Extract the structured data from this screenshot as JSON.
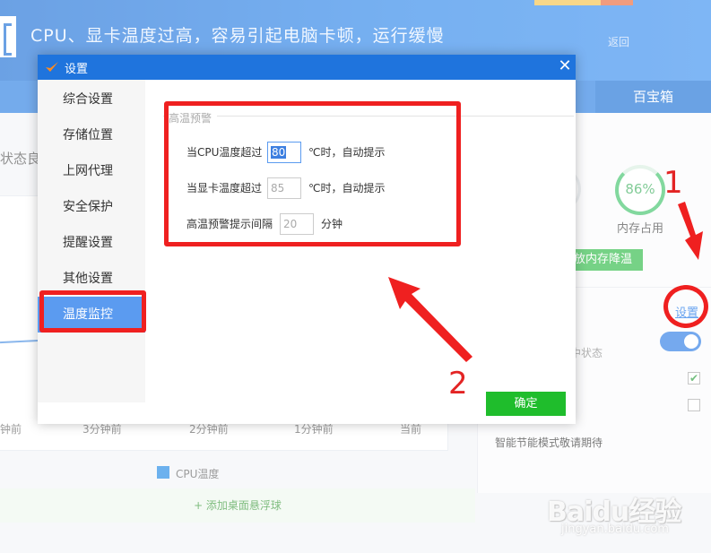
{
  "background": {
    "header_title": "CPU、显卡温度过高，容易引起电脑卡顿，运行缓慢",
    "header_link": "返回",
    "nav_right": "百宝箱",
    "status_text": "状态良",
    "ticks": [
      "钟前",
      "3分钟前",
      "2分钟前",
      "1分钟前",
      "当前"
    ],
    "legend": "CPU温度",
    "add_bar": "+ 添加桌面悬浮球",
    "memory_percent": "86%",
    "memory_label": "内存占用",
    "release_btn": "放内存降温",
    "settings_link": "设置",
    "state_label": "中状态",
    "smart_mode": "智能节能模式敬请期待"
  },
  "dialog": {
    "title": "设置",
    "close": "✕",
    "sidebar_items": [
      {
        "label": "综合设置"
      },
      {
        "label": "存储位置"
      },
      {
        "label": "上网代理"
      },
      {
        "label": "安全保护"
      },
      {
        "label": "提醒设置"
      },
      {
        "label": "其他设置"
      },
      {
        "label": "温度监控"
      }
    ],
    "section_title": "高温预警",
    "rows": [
      {
        "label": "当CPU温度超过",
        "value": "80",
        "unit": "℃时，自动提示"
      },
      {
        "label": "当显卡温度超过",
        "value": "85",
        "unit": "℃时，自动提示"
      },
      {
        "label": "高温预警提示间隔",
        "value": "20",
        "unit": "分钟"
      }
    ],
    "ok_label": "确定"
  },
  "annotations": {
    "n1": "1",
    "n2": "2"
  },
  "watermark": {
    "brand": "Baidu经验",
    "url": "jingyan.baidu.com"
  },
  "colors": {
    "accent": "#1f74dd",
    "active_nav": "#5b9bf0",
    "ok": "#1fbd2c",
    "annotation": "#ef2020"
  }
}
